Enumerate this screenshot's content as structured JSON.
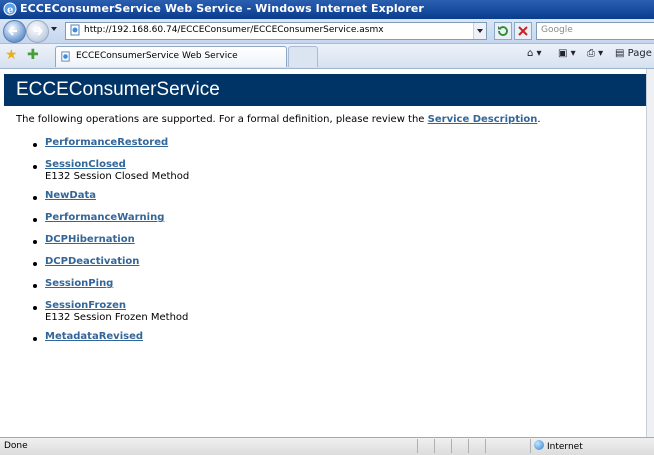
{
  "window": {
    "title": "ECCEConsumerService Web Service - Windows Internet Explorer"
  },
  "address_bar": {
    "url": "http://192.168.60.74/ECCEConsumer/ECCEConsumerService.asmx",
    "search_placeholder": "Google"
  },
  "tabs": [
    {
      "label": "ECCEConsumerService Web Service"
    }
  ],
  "toolbar": {
    "page_label": "Page"
  },
  "content": {
    "banner_title": "ECCEConsumerService",
    "intro_text": "The following operations are supported. For a formal definition, please review the",
    "intro_link": "Service Description",
    "intro_end": ".",
    "operations": [
      {
        "name": "PerformanceRestored",
        "description": ""
      },
      {
        "name": "SessionClosed",
        "description": "E132 Session Closed Method"
      },
      {
        "name": "NewData",
        "description": ""
      },
      {
        "name": "PerformanceWarning",
        "description": ""
      },
      {
        "name": "DCPHibernation",
        "description": ""
      },
      {
        "name": "DCPDeactivation",
        "description": ""
      },
      {
        "name": "SessionPing",
        "description": ""
      },
      {
        "name": "SessionFrozen",
        "description": "E132 Session Frozen Method"
      },
      {
        "name": "MetadataRevised",
        "description": ""
      }
    ]
  },
  "status_bar": {
    "status": "Done",
    "zone": "Internet"
  },
  "colors": {
    "banner_bg": "#003366",
    "link": "#336699"
  }
}
